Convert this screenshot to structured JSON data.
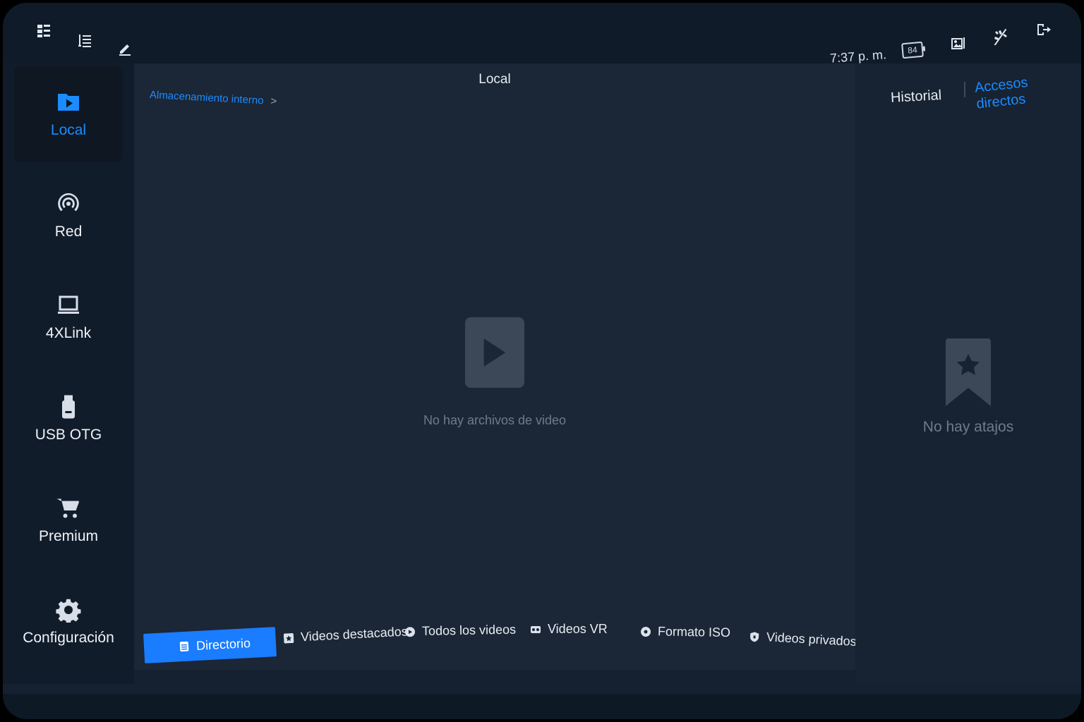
{
  "topbar": {
    "icons": [
      "grid-list-icon",
      "sort-list-icon",
      "edit-icon",
      "battery-icon",
      "gallery-icon",
      "no-effects-icon",
      "exit-icon"
    ],
    "time": "7:37 p. m.",
    "battery": "84"
  },
  "sidebar": {
    "items": [
      {
        "label": "Local",
        "icon": "folder-play-icon",
        "active": true
      },
      {
        "label": "Red",
        "icon": "network-icon",
        "active": false
      },
      {
        "label": "4XLink",
        "icon": "laptop-icon",
        "active": false
      },
      {
        "label": "USB OTG",
        "icon": "usb-icon",
        "active": false
      },
      {
        "label": "Premium",
        "icon": "cart-icon",
        "active": false
      },
      {
        "label": "Configuración",
        "icon": "gear-icon",
        "active": false
      }
    ]
  },
  "main": {
    "title": "Local",
    "breadcrumb": "Almacenamiento interno",
    "breadcrumb_sep": ">",
    "empty_text": "No hay archivos de video",
    "tabs": [
      {
        "label": "Directorio",
        "active": true
      },
      {
        "label": "Videos destacados",
        "active": false
      },
      {
        "label": "Todos los videos",
        "active": false
      },
      {
        "label": "Videos VR",
        "active": false
      },
      {
        "label": "Formato ISO",
        "active": false
      },
      {
        "label": "Videos privados",
        "active": false
      }
    ]
  },
  "right_panel": {
    "tab_history": "Historial",
    "tab_shortcuts": "Accesos directos",
    "empty_text": "No hay atajos"
  },
  "colors": {
    "accent": "#1a8cff",
    "background": "#1b2636",
    "sidebar": "#111c2a"
  }
}
